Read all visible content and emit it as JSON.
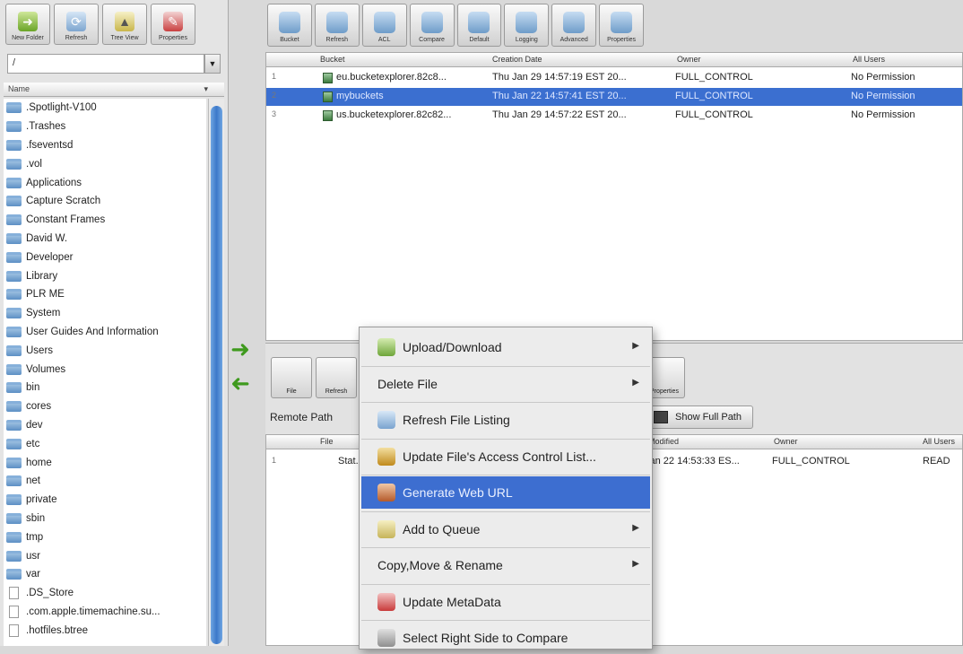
{
  "left_toolbar": {
    "buttons": [
      {
        "label": "New Folder",
        "icon": "new-folder-icon"
      },
      {
        "label": "Refresh",
        "icon": "refresh-icon"
      },
      {
        "label": "Tree View",
        "icon": "tree-view-icon"
      },
      {
        "label": "Properties",
        "icon": "properties-icon"
      }
    ]
  },
  "local_path": {
    "value": "/"
  },
  "tree": {
    "header": "Name",
    "items": [
      {
        "label": ".Spotlight-V100",
        "type": "folder"
      },
      {
        "label": ".Trashes",
        "type": "folder"
      },
      {
        "label": ".fseventsd",
        "type": "folder"
      },
      {
        "label": ".vol",
        "type": "folder"
      },
      {
        "label": "Applications",
        "type": "folder"
      },
      {
        "label": "Capture Scratch",
        "type": "folder"
      },
      {
        "label": "Constant Frames",
        "type": "folder"
      },
      {
        "label": "David W.",
        "type": "folder"
      },
      {
        "label": "Developer",
        "type": "folder"
      },
      {
        "label": "Library",
        "type": "folder"
      },
      {
        "label": "PLR ME",
        "type": "folder"
      },
      {
        "label": "System",
        "type": "folder"
      },
      {
        "label": "User Guides And Information",
        "type": "folder"
      },
      {
        "label": "Users",
        "type": "folder"
      },
      {
        "label": "Volumes",
        "type": "folder"
      },
      {
        "label": "bin",
        "type": "folder"
      },
      {
        "label": "cores",
        "type": "folder"
      },
      {
        "label": "dev",
        "type": "folder"
      },
      {
        "label": "etc",
        "type": "folder"
      },
      {
        "label": "home",
        "type": "folder"
      },
      {
        "label": "net",
        "type": "folder"
      },
      {
        "label": "private",
        "type": "folder"
      },
      {
        "label": "sbin",
        "type": "folder"
      },
      {
        "label": "tmp",
        "type": "folder"
      },
      {
        "label": "usr",
        "type": "folder"
      },
      {
        "label": "var",
        "type": "folder"
      },
      {
        "label": ".DS_Store",
        "type": "file"
      },
      {
        "label": ".com.apple.timemachine.su...",
        "type": "file"
      },
      {
        "label": ".hotfiles.btree",
        "type": "file"
      }
    ]
  },
  "right_toolbar": {
    "buttons": [
      {
        "label": "Bucket"
      },
      {
        "label": "Refresh"
      },
      {
        "label": "ACL"
      },
      {
        "label": "Compare"
      },
      {
        "label": "Default"
      },
      {
        "label": "Logging"
      },
      {
        "label": "Advanced"
      },
      {
        "label": "Properties"
      }
    ]
  },
  "bucket_table": {
    "columns": [
      "Bucket",
      "Creation Date",
      "Owner",
      "All Users"
    ],
    "rows": [
      {
        "num": "1",
        "bucket": "eu.bucketexplorer.82c8...",
        "date": "Thu Jan 29 14:57:19 EST 20...",
        "owner": "FULL_CONTROL",
        "all_users": "No Permission",
        "selected": false
      },
      {
        "num": "2",
        "bucket": "mybuckets",
        "date": "Thu Jan 22 14:57:41 EST 20...",
        "owner": "FULL_CONTROL",
        "all_users": "No Permission",
        "selected": true
      },
      {
        "num": "3",
        "bucket": "us.bucketexplorer.82c82...",
        "date": "Thu Jan 29 14:57:22 EST 20...",
        "owner": "FULL_CONTROL",
        "all_users": "No Permission",
        "selected": false
      }
    ]
  },
  "lower_toolbar": {
    "file_label": "File",
    "refresh_label": "Refresh",
    "properties_label": "Properties"
  },
  "remote_path": {
    "label": "Remote Path"
  },
  "show_full_path": {
    "label": "Show Full Path"
  },
  "file_table": {
    "columns": [
      "File",
      "Modified",
      "Owner",
      "All Users"
    ],
    "rows": [
      {
        "num": "1",
        "file": "Stat...",
        "modified": "Jan 22 14:53:33 ES...",
        "owner": "FULL_CONTROL",
        "all_users": "READ"
      }
    ]
  },
  "context_menu": {
    "items": [
      {
        "label": "Upload/Download",
        "submenu": true,
        "icon": "upload-download-icon",
        "selected": false
      },
      {
        "label": "Delete File",
        "submenu": true,
        "icon": "",
        "selected": false
      },
      {
        "label": "Refresh File Listing",
        "submenu": false,
        "icon": "refresh-icon",
        "selected": false
      },
      {
        "label": "Update File's Access Control List...",
        "submenu": false,
        "icon": "key-icon",
        "selected": false
      },
      {
        "label": "Generate Web URL",
        "submenu": false,
        "icon": "web-url-icon",
        "selected": true
      },
      {
        "label": "Add to Queue",
        "submenu": true,
        "icon": "queue-icon",
        "selected": false
      },
      {
        "label": "Copy,Move & Rename",
        "submenu": true,
        "icon": "",
        "selected": false
      },
      {
        "label": "Update MetaData",
        "submenu": false,
        "icon": "metadata-icon",
        "selected": false
      },
      {
        "label": "Select Right Side to Compare",
        "submenu": false,
        "icon": "compare-icon",
        "selected": false
      }
    ]
  },
  "colors": {
    "selection": "#3b6fd0",
    "accent_green": "#3f9a1e",
    "scroll_thumb": "#3c78c9"
  }
}
